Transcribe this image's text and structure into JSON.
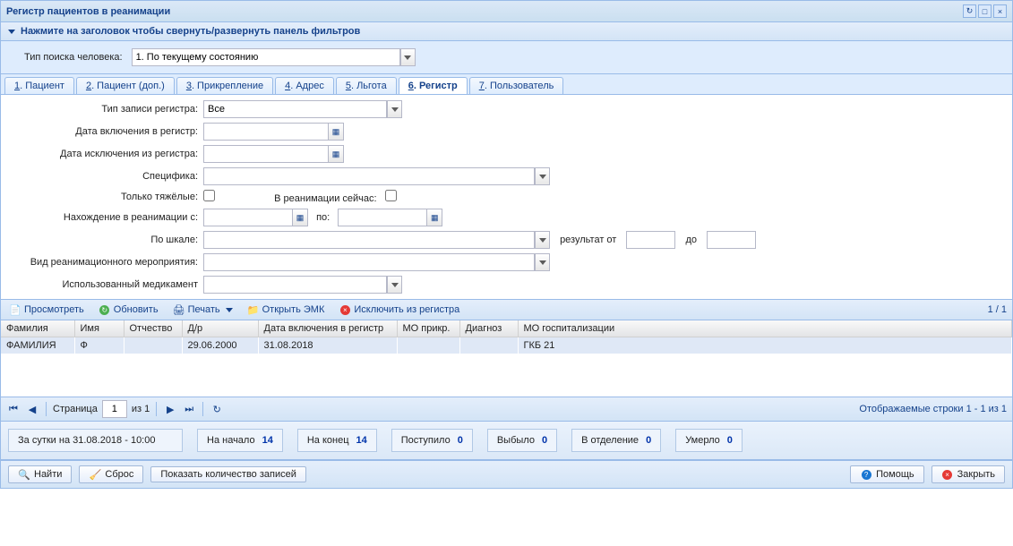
{
  "window": {
    "title": "Регистр пациентов в реанимации"
  },
  "filterPanel": {
    "hint": "Нажмите на заголовок чтобы свернуть/развернуть панель фильтров",
    "searchTypeLabel": "Тип поиска человека:",
    "searchTypeValue": "1. По текущему состоянию"
  },
  "tabs": [
    {
      "pref": "1",
      "label": "Пациент"
    },
    {
      "pref": "2",
      "label": "Пациент (доп.)"
    },
    {
      "pref": "3",
      "label": "Прикрепление"
    },
    {
      "pref": "4",
      "label": "Адрес"
    },
    {
      "pref": "5",
      "label": "Льгота"
    },
    {
      "pref": "6",
      "label": "Регистр",
      "active": true
    },
    {
      "pref": "7",
      "label": "Пользователь"
    }
  ],
  "form": {
    "recType": {
      "label": "Тип записи регистра:",
      "value": "Все"
    },
    "inclDate": {
      "label": "Дата включения в регистр:"
    },
    "exclDate": {
      "label": "Дата исключения из регистра:"
    },
    "specific": {
      "label": "Специфика:"
    },
    "severeOnly": {
      "label": "Только тяжёлые:"
    },
    "inReanimNow": {
      "label": "В реанимации сейчас:"
    },
    "stayFrom": {
      "label": "Нахождение в реанимации с:",
      "to": "по:"
    },
    "scale": {
      "label": "По шкале:",
      "resFrom": "результат от",
      "resTo": "до"
    },
    "eventType": {
      "label": "Вид реанимационного мероприятия:"
    },
    "drug": {
      "label": "Использованный медикамент"
    }
  },
  "toolbar": {
    "view": "Просмотреть",
    "refresh": "Обновить",
    "print": "Печать",
    "openEmk": "Открыть ЭМК",
    "exclude": "Исключить из регистра",
    "count": "1 / 1"
  },
  "grid": {
    "columns": [
      "Фамилия",
      "Имя",
      "Отчество",
      "Д/р",
      "Дата включения в регистр",
      "МО прикр.",
      "Диагноз",
      "МО госпитализации"
    ],
    "rows": [
      {
        "fam": "ФАМИЛИЯ",
        "name": "Ф",
        "pat": "",
        "dob": "29.06.2000",
        "incl": "31.08.2018",
        "mo": "",
        "diag": "",
        "hosp": "ГКБ 21"
      }
    ]
  },
  "pager": {
    "pageLabel": "Страница",
    "page": "1",
    "ofLabel": "из 1",
    "displayed": "Отображаемые строки 1 - 1 из 1"
  },
  "summary": {
    "asof": "За сутки на 31.08.2018 - 10:00",
    "start": {
      "l": "На начало",
      "v": "14"
    },
    "end": {
      "l": "На конец",
      "v": "14"
    },
    "in": {
      "l": "Поступило",
      "v": "0"
    },
    "out": {
      "l": "Выбыло",
      "v": "0"
    },
    "dept": {
      "l": "В отделение",
      "v": "0"
    },
    "dead": {
      "l": "Умерло",
      "v": "0"
    }
  },
  "footer": {
    "find": "Найти",
    "reset": "Сброс",
    "showCount": "Показать количество записей",
    "help": "Помощь",
    "close": "Закрыть"
  }
}
